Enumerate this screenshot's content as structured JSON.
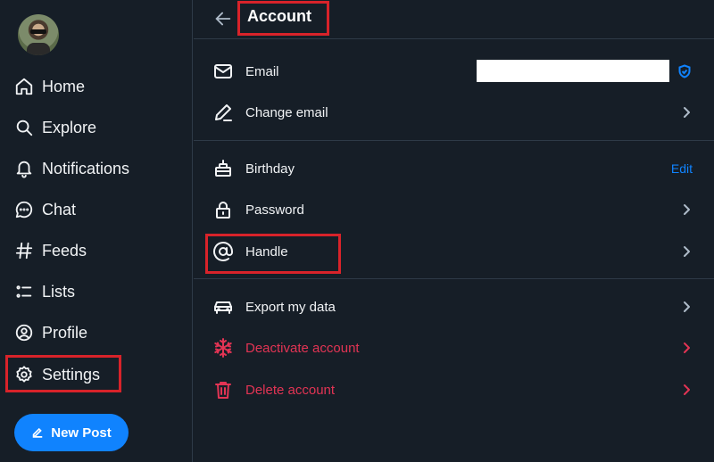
{
  "sidebar": {
    "items": [
      {
        "label": "Home",
        "icon": "home-icon"
      },
      {
        "label": "Explore",
        "icon": "search-icon"
      },
      {
        "label": "Notifications",
        "icon": "bell-icon"
      },
      {
        "label": "Chat",
        "icon": "chat-icon"
      },
      {
        "label": "Feeds",
        "icon": "hash-icon"
      },
      {
        "label": "Lists",
        "icon": "list-icon"
      },
      {
        "label": "Profile",
        "icon": "profile-icon"
      },
      {
        "label": "Settings",
        "icon": "gear-icon"
      }
    ],
    "new_post_label": "New Post"
  },
  "header": {
    "title": "Account"
  },
  "account": {
    "email_label": "Email",
    "change_email_label": "Change email",
    "birthday_label": "Birthday",
    "birthday_action": "Edit",
    "password_label": "Password",
    "handle_label": "Handle",
    "export_label": "Export my data",
    "deactivate_label": "Deactivate account",
    "delete_label": "Delete account"
  },
  "colors": {
    "background": "#161e27",
    "accent": "#1083fe",
    "danger": "#e23454",
    "highlight": "#d8232a"
  }
}
